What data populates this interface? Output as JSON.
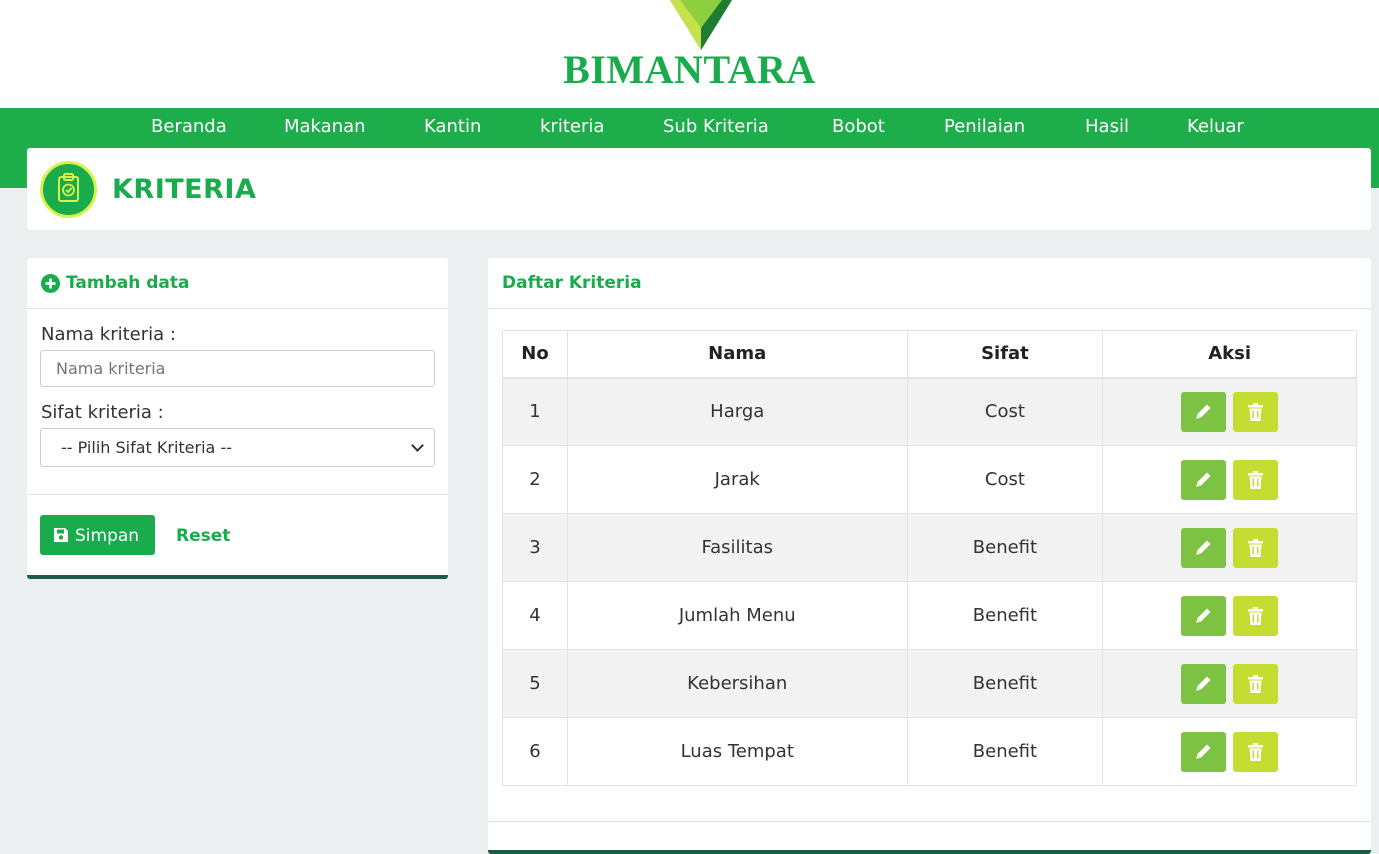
{
  "brand": {
    "name": "BIMANTARA"
  },
  "nav": {
    "items": [
      {
        "label": "Beranda"
      },
      {
        "label": "Makanan"
      },
      {
        "label": "Kantin"
      },
      {
        "label": "kriteria"
      },
      {
        "label": "Sub Kriteria"
      },
      {
        "label": "Bobot"
      },
      {
        "label": "Penilaian"
      },
      {
        "label": "Hasil"
      },
      {
        "label": "Keluar"
      }
    ]
  },
  "header": {
    "title": "KRITERIA",
    "icon": "clipboard-check-icon"
  },
  "form": {
    "title": "Tambah data",
    "title_icon": "plus-circle-icon",
    "name_label": "Nama kriteria :",
    "name_placeholder": "Nama kriteria",
    "name_value": "",
    "sifat_label": "Sifat kriteria :",
    "sifat_selected": "-- Pilih Sifat Kriteria --",
    "save_label": "Simpan",
    "save_icon": "save-icon",
    "reset_label": "Reset"
  },
  "list": {
    "title": "Daftar Kriteria",
    "columns": {
      "no": "No",
      "nama": "Nama",
      "sifat": "Sifat",
      "aksi": "Aksi"
    },
    "rows": [
      {
        "no": "1",
        "nama": "Harga",
        "sifat": "Cost"
      },
      {
        "no": "2",
        "nama": "Jarak",
        "sifat": "Cost"
      },
      {
        "no": "3",
        "nama": "Fasilitas",
        "sifat": "Benefit"
      },
      {
        "no": "4",
        "nama": "Jumlah Menu",
        "sifat": "Benefit"
      },
      {
        "no": "5",
        "nama": "Kebersihan",
        "sifat": "Benefit"
      },
      {
        "no": "6",
        "nama": "Luas Tempat",
        "sifat": "Benefit"
      }
    ],
    "edit_icon": "pencil-icon",
    "delete_icon": "trash-icon"
  },
  "colors": {
    "primary": "#1aab4c",
    "navbar": "#1dad4b",
    "edit_button": "#7dc243",
    "delete_button": "#c5dc32",
    "card_border": "#155e45",
    "background": "#eceff0"
  }
}
